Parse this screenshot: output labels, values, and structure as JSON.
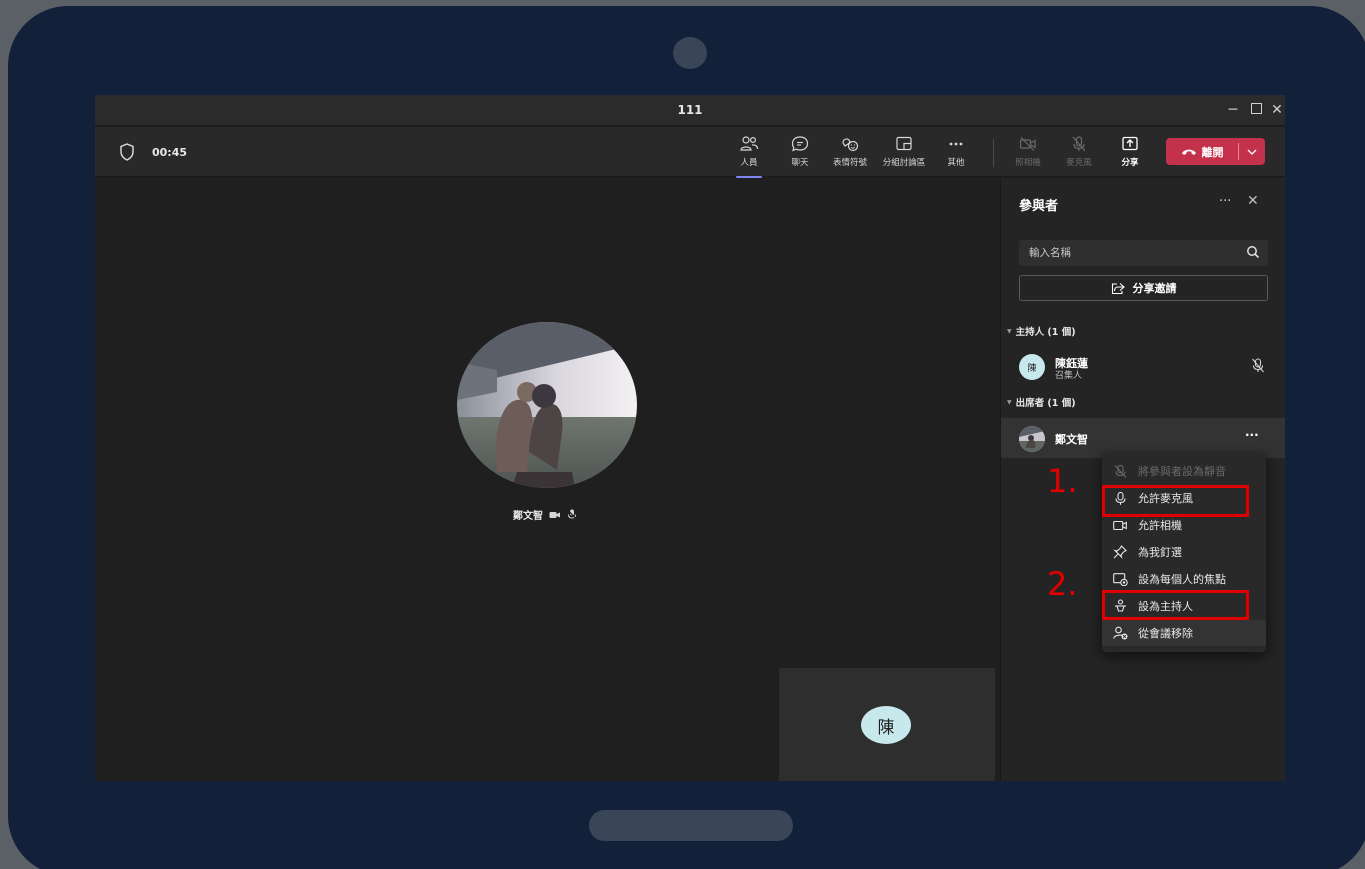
{
  "window": {
    "title": "111"
  },
  "toolbar": {
    "timer": "00:45",
    "buttons": {
      "people": "人員",
      "chat": "聊天",
      "reactions": "表情符號",
      "breakout": "分組討論區",
      "more": "其他",
      "camera": "照相機",
      "mic": "麥克風",
      "share": "分享"
    },
    "leave_label": "離開"
  },
  "stage": {
    "participant_name": "鄭文智",
    "self_initial": "陳"
  },
  "panel": {
    "title": "參與者",
    "search_placeholder": "輸入名稱",
    "share_invite": "分享邀請",
    "organizers_header": "主持人 (1 個)",
    "organizer": {
      "initial": "陳",
      "name": "陳鈺蓮",
      "role": "召集人"
    },
    "attendees_header": "出席者 (1 個)",
    "attendee": {
      "name": "鄭文智"
    }
  },
  "context_menu": {
    "items": [
      "將參與者設為靜音",
      "允許麥克風",
      "允許相機",
      "為我釘選",
      "設為每個人的焦點",
      "設為主持人",
      "從會議移除"
    ]
  },
  "annotations": {
    "step1": "1.",
    "step2": "2."
  },
  "colors": {
    "accent": "#7f85f5",
    "leave": "#c4314b",
    "annotation": "#e00000"
  }
}
